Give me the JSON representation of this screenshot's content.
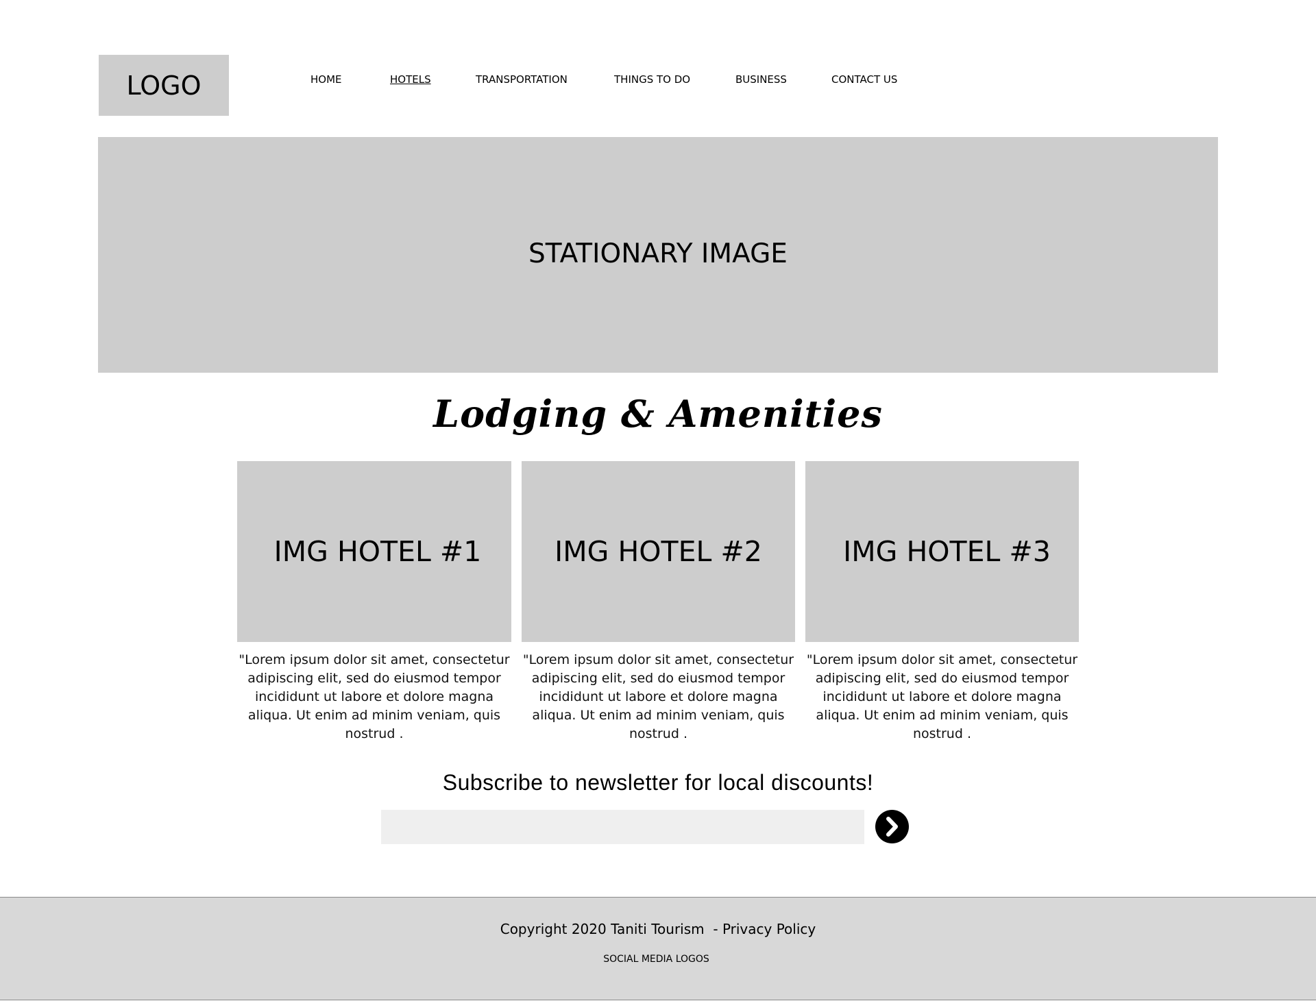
{
  "header": {
    "logo": "LOGO",
    "nav": [
      {
        "label": "HOME",
        "active": false
      },
      {
        "label": "HOTELS",
        "active": true
      },
      {
        "label": "TRANSPORTATION",
        "active": false
      },
      {
        "label": "THINGS TO DO",
        "active": false
      },
      {
        "label": "BUSINESS",
        "active": false
      },
      {
        "label": "CONTACT US",
        "active": false
      }
    ]
  },
  "hero": {
    "label": "STATIONARY IMAGE"
  },
  "lodging": {
    "title": "Lodging & Amenities",
    "cards": [
      {
        "image_label": "IMG HOTEL #1",
        "description": "\"Lorem ipsum dolor sit amet, consectetur adipiscing elit, sed do eiusmod tempor incididunt ut labore et dolore magna aliqua. Ut enim ad minim veniam, quis nostrud ."
      },
      {
        "image_label": "IMG HOTEL #2",
        "description": "\"Lorem ipsum dolor sit amet, consectetur adipiscing elit, sed do eiusmod tempor incididunt ut labore et dolore magna aliqua. Ut enim ad minim veniam, quis nostrud ."
      },
      {
        "image_label": "IMG HOTEL #3",
        "description": "\"Lorem ipsum dolor sit amet, consectetur adipiscing elit, sed do eiusmod tempor incididunt ut labore et dolore magna aliqua. Ut enim ad minim veniam, quis nostrud ."
      }
    ]
  },
  "newsletter": {
    "title": "Subscribe to newsletter for local discounts!",
    "input_value": "",
    "submit_icon": "chevron-right-circle-icon"
  },
  "footer": {
    "copyright": "Copyright 2020 Taniti Tourism  - ",
    "privacy": "Privacy Policy",
    "social": "SOCIAL MEDIA LOGOS"
  },
  "colors": {
    "placeholder_gray": "#cdcdcd",
    "input_bg": "#efefef",
    "footer_bg": "#d8d8d8",
    "accent": "#000000"
  }
}
